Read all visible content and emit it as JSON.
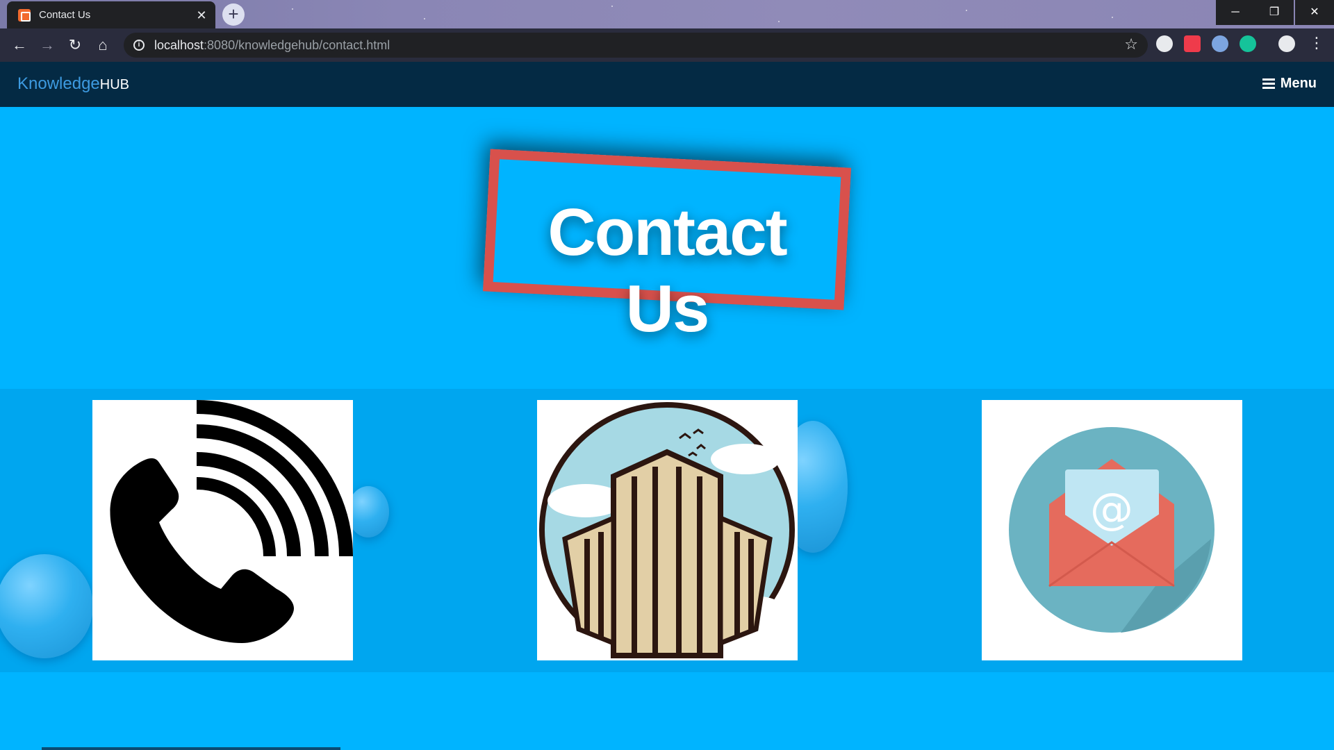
{
  "browser": {
    "tab_title": "Contact Us",
    "url_host": "localhost",
    "url_rest": ":8080/knowledgehub/contact.html",
    "window_controls": {
      "minimize": "─",
      "maximize": "❐",
      "close": "✕"
    },
    "new_tab_symbol": "+",
    "nav_icons": {
      "back": "←",
      "forward": "→",
      "reload": "↻",
      "home": "⌂"
    },
    "bookmark_symbol": "☆",
    "menu_symbol": "⋮",
    "tab_close_symbol": "✕"
  },
  "site": {
    "brand_primary": "Knowledge",
    "brand_secondary": "HUB",
    "menu_label": "Menu",
    "hero_title": "Contact Us"
  },
  "cards": [
    {
      "icon": "phone-icon"
    },
    {
      "icon": "building-icon"
    },
    {
      "icon": "email-icon"
    }
  ],
  "colors": {
    "page_bg": "#00b4ff",
    "band_bg": "#00a6ef",
    "nav_bg": "#042a44",
    "frame_red": "#d8514c",
    "brand_blue": "#3d9ae0"
  }
}
